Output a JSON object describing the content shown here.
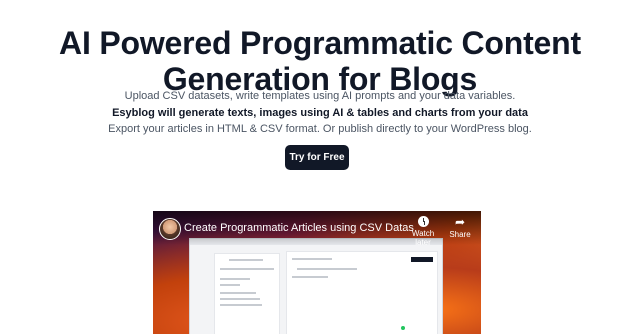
{
  "hero": {
    "title_line1": "AI Powered Programmatic Content",
    "title_line2": "Generation for Blogs"
  },
  "description": {
    "line1": "Upload CSV datasets, write templates using AI prompts and your data variables.",
    "line2": "Esyblog will generate texts, images using AI & tables and charts from your data",
    "line3": "Export your articles in HTML & CSV format. Or publish directly to your WordPress blog."
  },
  "cta": {
    "label": "Try for Free"
  },
  "video": {
    "title": "Create Programmatic Articles using CSV Dataset ...",
    "watch_later_label": "Watch later",
    "share_label": "Share",
    "icons": {
      "avatar": "channel-avatar",
      "watch_later": "clock-icon",
      "share": "share-arrow-icon"
    }
  },
  "colors": {
    "title": "#111827",
    "button_bg": "#111827",
    "body_text": "#4b5563"
  }
}
